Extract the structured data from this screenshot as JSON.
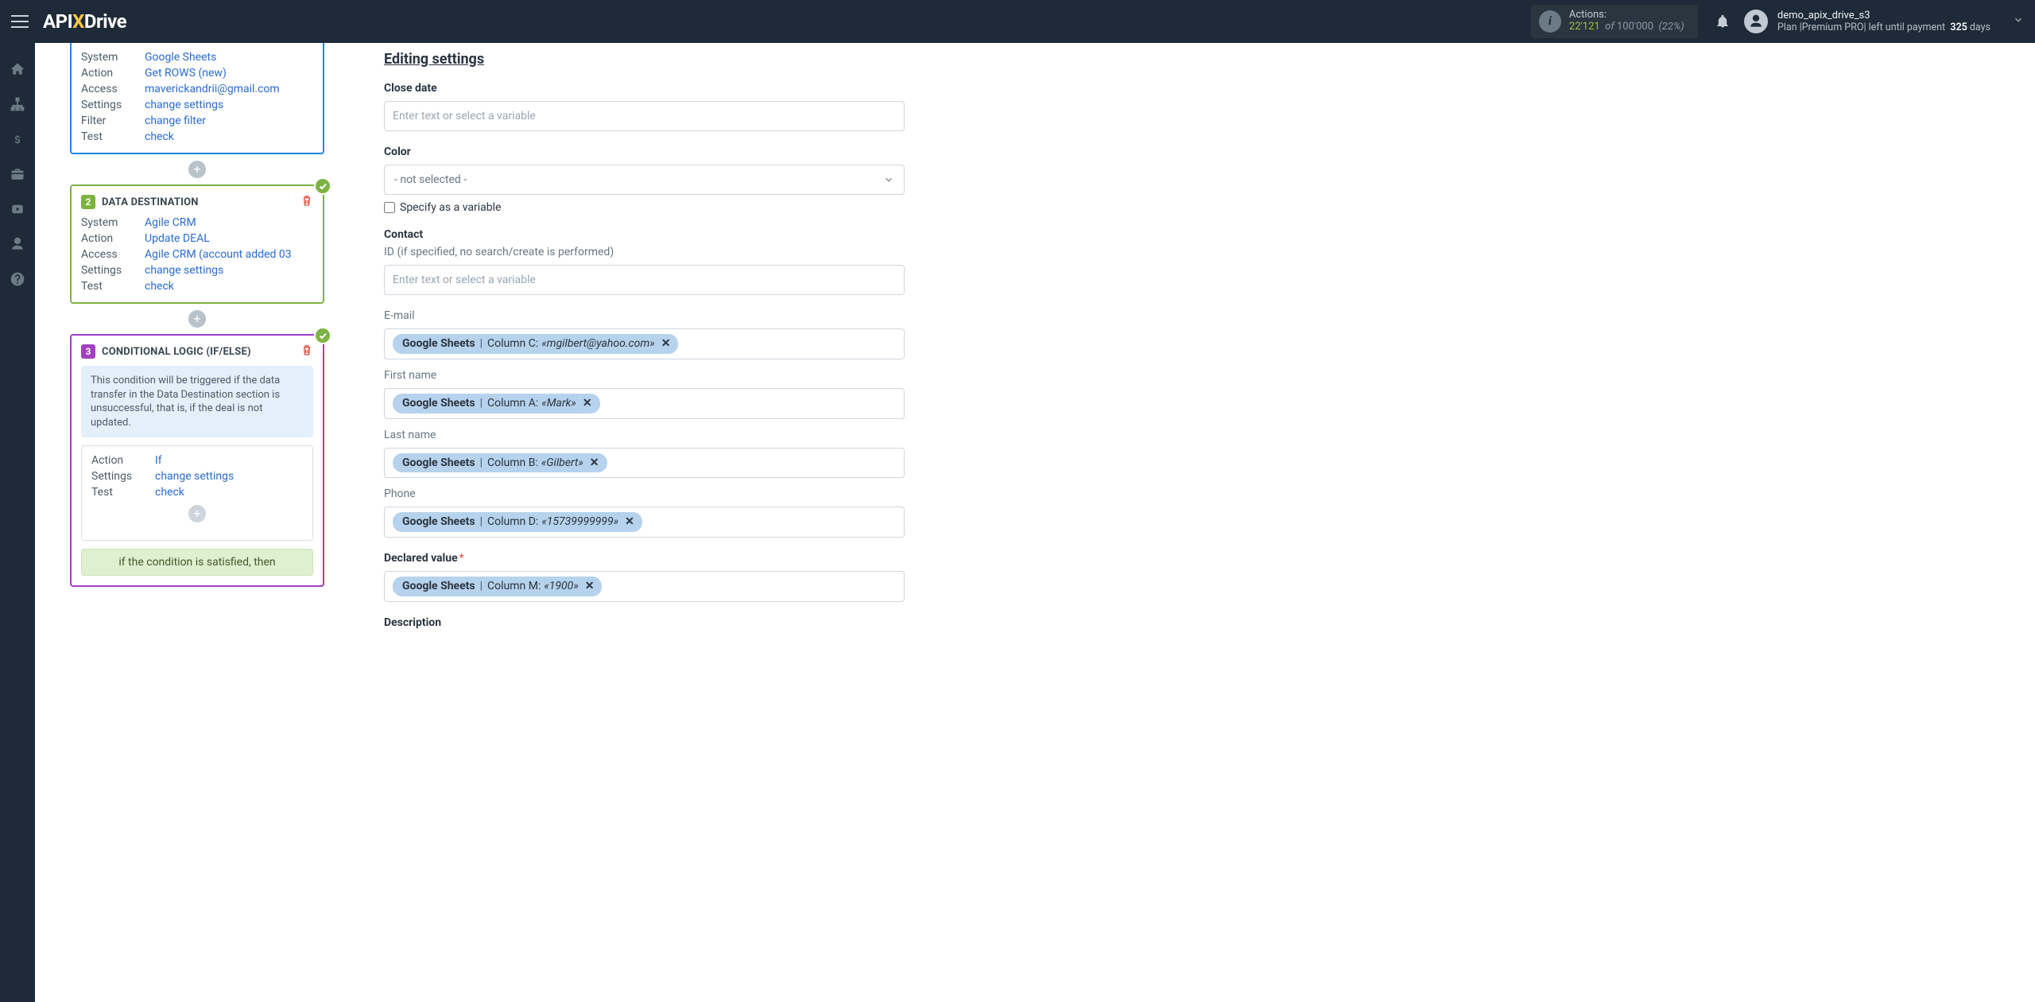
{
  "topbar": {
    "logo_a": "API",
    "logo_b": "Drive",
    "actions_label": "Actions:",
    "actions_used": "22'121",
    "actions_of": "of",
    "actions_total": "100'000",
    "actions_pct": "(22%)",
    "user_name": "demo_apix_drive_s3",
    "plan_prefix": "Plan |",
    "plan_name": "Premium PRO",
    "plan_mid": "| left until payment",
    "plan_days_num": "325",
    "plan_days_suffix": "days"
  },
  "steps": {
    "source": {
      "rows": {
        "system_k": "System",
        "system_v": "Google Sheets",
        "action_k": "Action",
        "action_v": "Get ROWS (new)",
        "access_k": "Access",
        "access_v": "maverickandrii@gmail.com",
        "settings_k": "Settings",
        "settings_v": "change settings",
        "filter_k": "Filter",
        "filter_v": "change filter",
        "test_k": "Test",
        "test_v": "check"
      }
    },
    "dest": {
      "badge": "2",
      "title": "DATA DESTINATION",
      "rows": {
        "system_k": "System",
        "system_v": "Agile CRM",
        "action_k": "Action",
        "action_v": "Update DEAL",
        "access_k": "Access",
        "access_v": "Agile CRM (account added 03",
        "settings_k": "Settings",
        "settings_v": "change settings",
        "test_k": "Test",
        "test_v": "check"
      }
    },
    "cond": {
      "badge": "3",
      "title": "CONDITIONAL LOGIC (IF/ELSE)",
      "note": "This condition will be triggered if the data transfer in the Data Destination section is unsuccessful, that is, if the deal is not updated.",
      "rows": {
        "action_k": "Action",
        "action_v": "If",
        "settings_k": "Settings",
        "settings_v": "change settings",
        "test_k": "Test",
        "test_v": "check"
      },
      "then": "if the condition is satisfied, then"
    }
  },
  "form": {
    "title": "Editing settings",
    "close_date_label": "Close date",
    "placeholder_var": "Enter text or select a variable",
    "color_label": "Color",
    "color_value": "- not selected -",
    "specify_var": "Specify as a variable",
    "contact_label": "Contact",
    "contact_id_label": "ID (if specified, no search/create is performed)",
    "email_label": "E-mail",
    "firstname_label": "First name",
    "lastname_label": "Last name",
    "phone_label": "Phone",
    "declared_label": "Declared value",
    "description_label": "Description",
    "chips": {
      "src": "Google Sheets",
      "email_col": "Column C:",
      "email_val": "«mgilbert@yahoo.com»",
      "first_col": "Column A:",
      "first_val": "«Mark»",
      "last_col": "Column B:",
      "last_val": "«Gilbert»",
      "phone_col": "Column D:",
      "phone_val": "«15739999999»",
      "decl_col": "Column M:",
      "decl_val": "«1900»"
    }
  }
}
